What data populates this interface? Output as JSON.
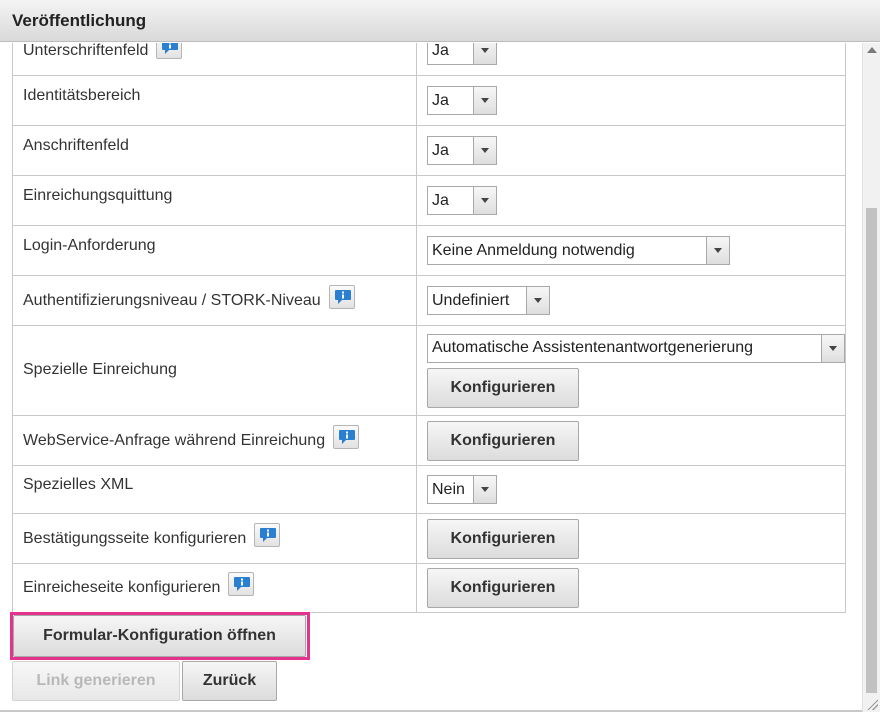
{
  "dialog": {
    "title": "Veröffentlichung"
  },
  "rows": {
    "signature": {
      "label": "Unterschriftenfeld",
      "value": "Ja"
    },
    "identity": {
      "label": "Identitätsbereich",
      "value": "Ja"
    },
    "address": {
      "label": "Anschriftenfeld",
      "value": "Ja"
    },
    "receipt": {
      "label": "Einreichungsquittung",
      "value": "Ja"
    },
    "login": {
      "label": "Login-Anforderung",
      "value": "Keine Anmeldung notwendig"
    },
    "auth": {
      "label": "Authentifizierungsniveau / STORK-Niveau",
      "value": "Undefiniert"
    },
    "special_submission": {
      "label": "Spezielle Einreichung",
      "value": "Automatische Assistentenantwortgenerierung",
      "button": "Konfigurieren"
    },
    "webservice": {
      "label": "WebService-Anfrage während Einreichung",
      "button": "Konfigurieren"
    },
    "special_xml": {
      "label": "Spezielles XML",
      "value": "Nein"
    },
    "confirmation_page": {
      "label": "Bestätigungsseite konfigurieren",
      "button": "Konfigurieren"
    },
    "submit_page": {
      "label": "Einreicheseite konfigurieren",
      "button": "Konfigurieren"
    }
  },
  "actions": {
    "open_form_config": "Formular-Konfiguration öffnen",
    "generate_link": "Link generieren",
    "back": "Zurück"
  },
  "colors": {
    "highlight": "#e4338f",
    "info_icon": "#2a7fd0"
  }
}
